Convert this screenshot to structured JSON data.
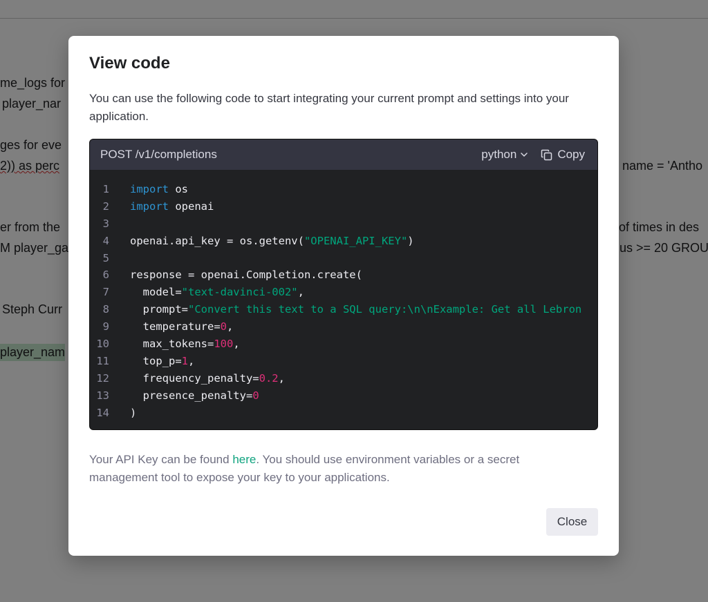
{
  "background": {
    "fragments": [
      "me_logs for",
      "player_nar",
      "ges for eve",
      "2)) as perc",
      "name = 'Antho",
      "er from the",
      "of times in des",
      "M player_ga",
      "us >= 20 GROU",
      "Steph Curr",
      "player_nam"
    ]
  },
  "modal": {
    "title": "View code",
    "description": "You can use the following code to start integrating your current prompt and settings into your application.",
    "code_card": {
      "endpoint": "POST /v1/completions",
      "language": "python",
      "copy_label": "Copy",
      "lines": [
        {
          "n": "1",
          "parts": [
            {
              "t": "import",
              "c": "kw"
            },
            {
              "t": " os",
              "c": ""
            }
          ]
        },
        {
          "n": "2",
          "parts": [
            {
              "t": "import",
              "c": "kw"
            },
            {
              "t": " openai",
              "c": ""
            }
          ]
        },
        {
          "n": "3",
          "parts": []
        },
        {
          "n": "4",
          "parts": [
            {
              "t": "openai.api_key = os.getenv(",
              "c": ""
            },
            {
              "t": "\"OPENAI_API_KEY\"",
              "c": "str"
            },
            {
              "t": ")",
              "c": ""
            }
          ]
        },
        {
          "n": "5",
          "parts": []
        },
        {
          "n": "6",
          "parts": [
            {
              "t": "response = openai.Completion.create(",
              "c": ""
            }
          ]
        },
        {
          "n": "7",
          "parts": [
            {
              "t": "  model=",
              "c": ""
            },
            {
              "t": "\"text-davinci-002\"",
              "c": "str"
            },
            {
              "t": ",",
              "c": ""
            }
          ]
        },
        {
          "n": "8",
          "parts": [
            {
              "t": "  prompt=",
              "c": ""
            },
            {
              "t": "\"Convert this text to a SQL query:\\n\\nExample: Get all Lebron",
              "c": "str"
            }
          ]
        },
        {
          "n": "9",
          "parts": [
            {
              "t": "  temperature=",
              "c": ""
            },
            {
              "t": "0",
              "c": "num"
            },
            {
              "t": ",",
              "c": ""
            }
          ]
        },
        {
          "n": "10",
          "parts": [
            {
              "t": "  max_tokens=",
              "c": ""
            },
            {
              "t": "100",
              "c": "num"
            },
            {
              "t": ",",
              "c": ""
            }
          ]
        },
        {
          "n": "11",
          "parts": [
            {
              "t": "  top_p=",
              "c": ""
            },
            {
              "t": "1",
              "c": "num"
            },
            {
              "t": ",",
              "c": ""
            }
          ]
        },
        {
          "n": "12",
          "parts": [
            {
              "t": "  frequency_penalty=",
              "c": ""
            },
            {
              "t": "0.2",
              "c": "num"
            },
            {
              "t": ",",
              "c": ""
            }
          ]
        },
        {
          "n": "13",
          "parts": [
            {
              "t": "  presence_penalty=",
              "c": ""
            },
            {
              "t": "0",
              "c": "num"
            }
          ]
        },
        {
          "n": "14",
          "parts": [
            {
              "t": ")",
              "c": ""
            }
          ]
        }
      ]
    },
    "note_before_link": "Your API Key can be found ",
    "note_link": "here",
    "note_after_link": ". You should use environment variables or a secret management tool to expose your key to your applications.",
    "close_label": "Close"
  },
  "colors": {
    "overlay": "#00000080",
    "code_bg": "#202123",
    "code_header_bg": "#343541",
    "keyword": "#2e95d3",
    "string": "#00a67d",
    "number": "#df3079",
    "link": "#10a37f"
  },
  "icons": {
    "language_dropdown": "chevron-down-icon",
    "copy": "copy-icon"
  }
}
